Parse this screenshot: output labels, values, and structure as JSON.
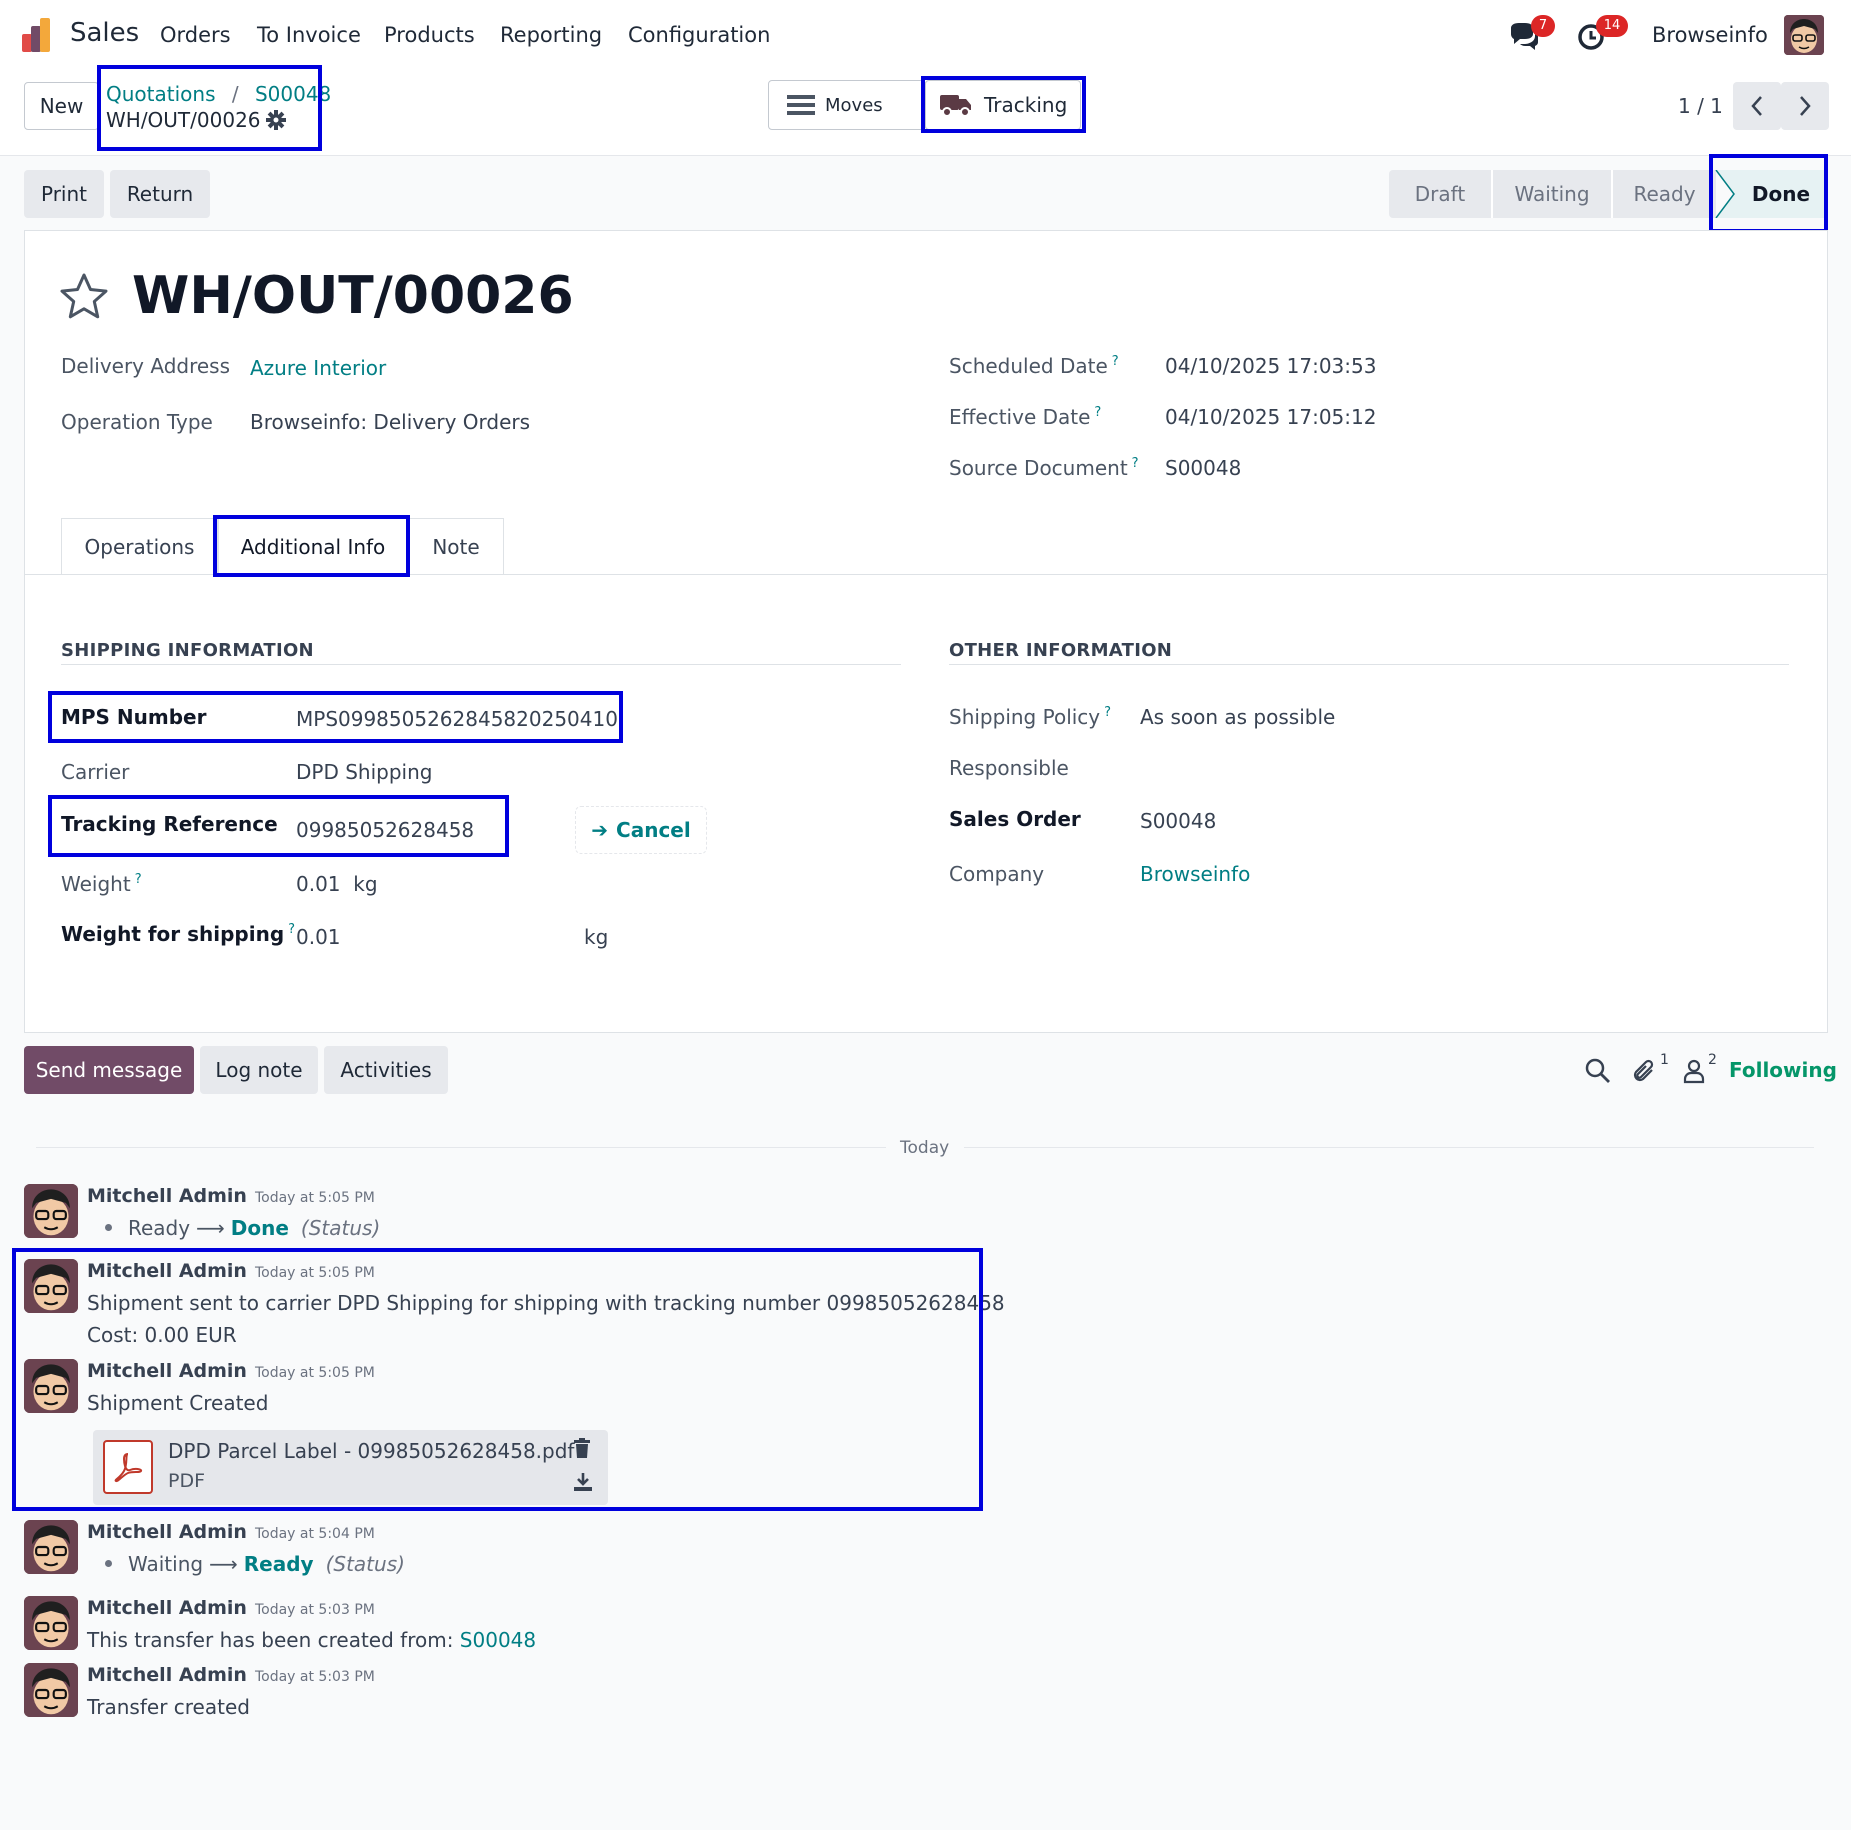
{
  "navbar": {
    "app_name": "Sales",
    "menus": [
      "Orders",
      "To Invoice",
      "Products",
      "Reporting",
      "Configuration"
    ],
    "messages_badge": "7",
    "activities_badge": "14",
    "user_name": "Browseinfo"
  },
  "control": {
    "new_label": "New",
    "breadcrumb_parent": "Quotations",
    "breadcrumb_sep": "/",
    "breadcrumb_order": "S00048",
    "record_name": "WH/OUT/00026",
    "moves_label": "Moves",
    "tracking_label": "Tracking",
    "pager": "1 / 1"
  },
  "actions": {
    "print_label": "Print",
    "return_label": "Return"
  },
  "status": {
    "steps": [
      "Draft",
      "Waiting",
      "Ready",
      "Done"
    ],
    "current": "Done"
  },
  "form": {
    "title": "WH/OUT/00026",
    "delivery_address_label": "Delivery Address",
    "delivery_address": "Azure Interior",
    "operation_type_label": "Operation Type",
    "operation_type": "Browseinfo: Delivery Orders",
    "scheduled_date_label": "Scheduled Date",
    "scheduled_date": "04/10/2025 17:03:53",
    "effective_date_label": "Effective Date",
    "effective_date": "04/10/2025 17:05:12",
    "source_document_label": "Source Document",
    "source_document": "S00048",
    "help_mark": "?"
  },
  "tabs": [
    "Operations",
    "Additional Info",
    "Note"
  ],
  "shipping": {
    "title": "SHIPPING INFORMATION",
    "mps_label": "MPS Number",
    "mps_value": "MPS09985052628458202504​10",
    "carrier_label": "Carrier",
    "carrier_value": "DPD Shipping",
    "tracking_label": "Tracking Reference",
    "tracking_value": "09985052628458",
    "cancel_label": "Cancel",
    "weight_label": "Weight",
    "weight_value": "0.01",
    "weight_unit": "kg",
    "weight_ship_label": "Weight for shipping",
    "weight_ship_value": "0.01",
    "weight_ship_unit": "kg"
  },
  "other": {
    "title": "OTHER INFORMATION",
    "policy_label": "Shipping Policy",
    "policy_value": "As soon as possible",
    "responsible_label": "Responsible",
    "sales_order_label": "Sales Order",
    "sales_order_value": "S00048",
    "company_label": "Company",
    "company_value": "Browseinfo"
  },
  "chatter": {
    "send_label": "Send message",
    "log_label": "Log note",
    "activities_label": "Activities",
    "attachments_count": "1",
    "followers_count": "2",
    "following_label": "Following",
    "day_label": "Today",
    "messages": [
      {
        "author": "Mitchell Admin",
        "time": "Today at 5:05 PM",
        "from": "Ready",
        "to": "Done",
        "field": "(Status)"
      },
      {
        "author": "Mitchell Admin",
        "time": "Today at 5:05 PM",
        "line1": "Shipment sent to carrier DPD Shipping for shipping with tracking number 09985052628458",
        "line2": "Cost: 0.00 EUR"
      },
      {
        "author": "Mitchell Admin",
        "time": "Today at 5:05 PM",
        "body": "Shipment Created",
        "attachment_name": "DPD Parcel Label - 09985052628458.pdf",
        "attachment_type": "PDF"
      },
      {
        "author": "Mitchell Admin",
        "time": "Today at 5:04 PM",
        "from": "Waiting",
        "to": "Ready",
        "field": "(Status)"
      },
      {
        "author": "Mitchell Admin",
        "time": "Today at 5:03 PM",
        "body": "This transfer has been created from:",
        "link": "S00048"
      },
      {
        "author": "Mitchell Admin",
        "time": "Today at 5:03 PM",
        "body": "Transfer created"
      }
    ]
  },
  "colors": {
    "brand": "#714b67",
    "link": "#017e84",
    "highlight": "#0000dd",
    "badge": "#dc2626",
    "following": "#059669"
  }
}
